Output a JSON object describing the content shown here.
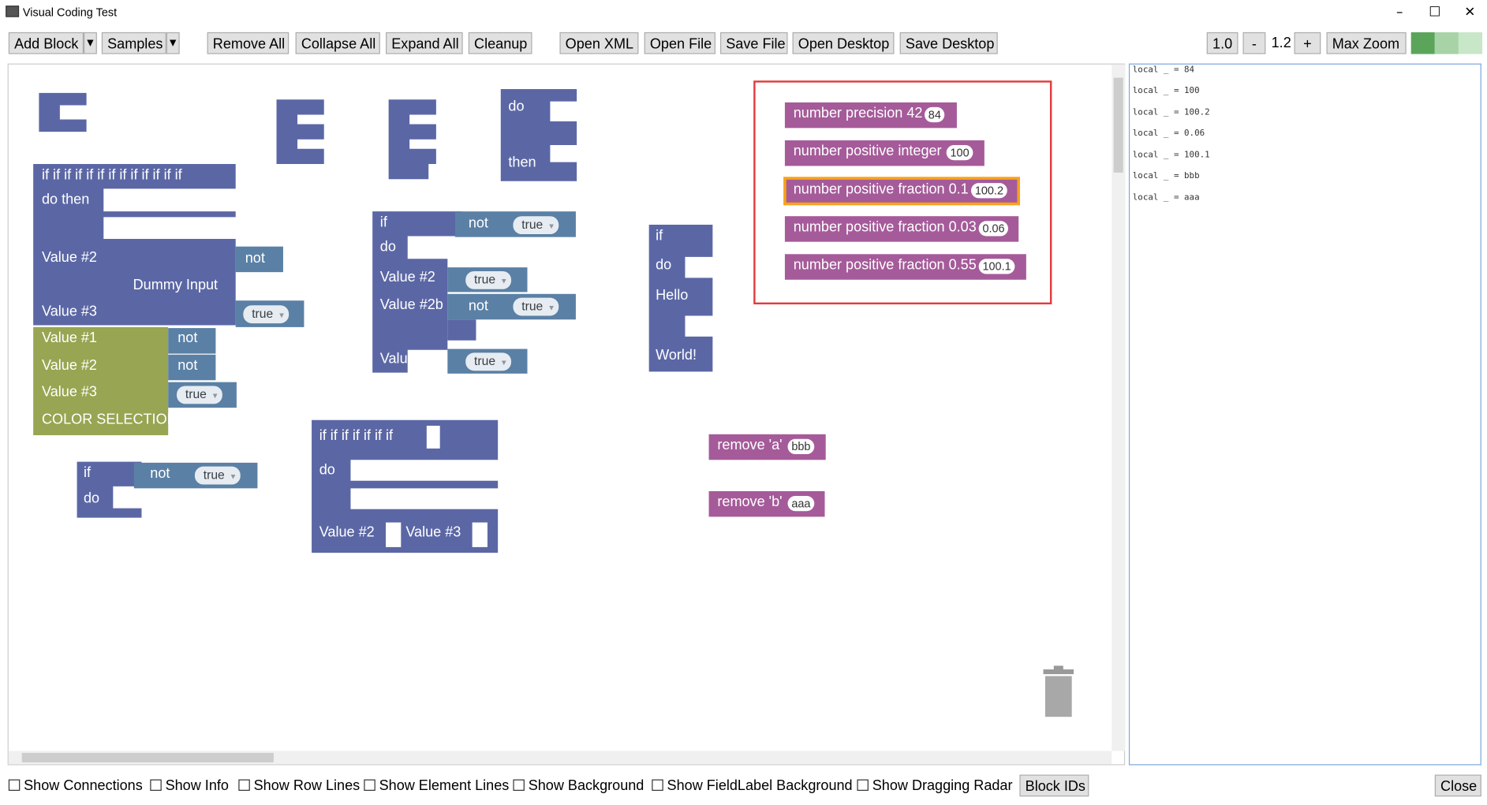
{
  "window": {
    "title": "Visual Coding Test",
    "minimize": "–",
    "maximize": "☐",
    "close": "✕"
  },
  "toolbar": {
    "add_block": "Add Block",
    "samples": "Samples",
    "remove_all": "Remove All",
    "collapse_all": "Collapse All",
    "expand_all": "Expand All",
    "cleanup": "Cleanup",
    "open_xml": "Open XML",
    "open_file": "Open File",
    "save_file": "Save File",
    "open_desktop": "Open Desktop",
    "save_desktop": "Save Desktop",
    "zoom_reset": "1.0",
    "zoom_minus": "-",
    "zoom_value": "1.2",
    "zoom_plus": "+",
    "max_zoom": "Max Zoom",
    "dropdown_arrow": "▼"
  },
  "colors": {
    "logic": "#5b67a5",
    "logic_field": "#5b80a5",
    "color_block": "#98a552",
    "text_block": "#a55b99",
    "swatch1": "#5ba55b",
    "swatch2": "#a7d3a7",
    "swatch3": "#c8e6c8",
    "highlight": "#f7a21b",
    "selection_box": "#e23b3b"
  },
  "blocks": {
    "b_if_chain": "if if if if if if if if if  if if  if if",
    "b_do_then": "do then",
    "b_value2": "Value #2",
    "b_dummy": "Dummy Input",
    "b_value3": "Value #3",
    "not": "not",
    "true": "true",
    "c_value1": "Value #1",
    "c_value2": "Value #2",
    "c_value3": "Value #3",
    "c_color_selection": "COLOR SELECTION",
    "if": "if",
    "do": "do",
    "then": "then",
    "value2": "Value #2",
    "value2b": "Value #2b",
    "value3": "Value #3",
    "if7": "if if if if if if if",
    "hello": "Hello",
    "world": "World!",
    "remove_a": "remove 'a'",
    "remove_a_val": "bbb",
    "remove_b": "remove 'b'",
    "remove_b_val": "aaa",
    "num1": "number precision 42",
    "num1_val": "84",
    "num2": "number positive integer",
    "num2_val": "100",
    "num3": "number positive fraction 0.1",
    "num3_val": "100.2",
    "num4": "number positive fraction 0.03",
    "num4_val": "0.06",
    "num5": "number positive fraction 0.55",
    "num5_val": "100.1"
  },
  "output": {
    "lines": [
      "local _ = 84",
      "local _ = 100",
      "local _ = 100.2",
      "local _ = 0.06",
      "local _ = 100.1",
      "local _ = bbb",
      "local _ = aaa"
    ]
  },
  "options": {
    "show_connections": "Show Connections",
    "show_info": "Show Info",
    "show_row_lines": "Show Row Lines",
    "show_element_lines": "Show Element Lines",
    "show_background": "Show Background",
    "show_fieldlabel_background": "Show FieldLabel Background",
    "show_dragging_radar": "Show Dragging Radar",
    "block_ids": "Block IDs",
    "close": "Close"
  }
}
